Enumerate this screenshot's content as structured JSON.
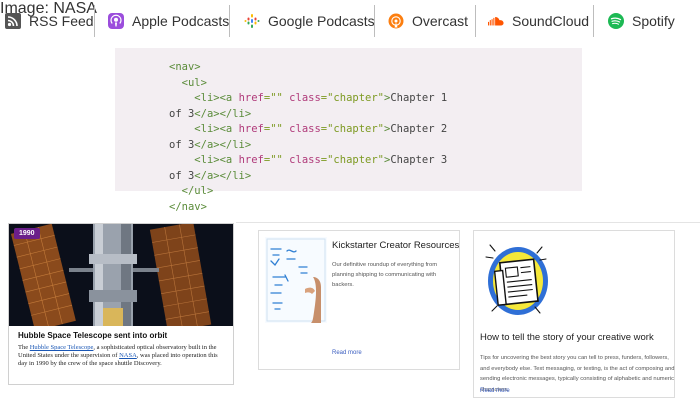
{
  "podcast_links": [
    {
      "label": "RSS Feed",
      "icon": "rss-icon",
      "color": "#555555"
    },
    {
      "label": "Apple Podcasts",
      "icon": "apple-podcasts-icon",
      "color": "#9b4ddc"
    },
    {
      "label": "Google Podcasts",
      "icon": "google-podcasts-icon",
      "color": "#4285f4"
    },
    {
      "label": "Overcast",
      "icon": "overcast-icon",
      "color": "#fc7e0f"
    },
    {
      "label": "SoundCloud",
      "icon": "soundcloud-icon",
      "color": "#ff5500"
    },
    {
      "label": "Spotify",
      "icon": "spotify-icon",
      "color": "#1db954"
    }
  ],
  "code": {
    "nav_open": "<nav>",
    "ul_open": "<ul>",
    "li_open": "<li>",
    "a_open": "<a",
    "href_attr": "href",
    "href_value": "=\"\"",
    "class_attr": "class",
    "class_value": "=\"chapter\"",
    "tag_close": ">",
    "items": [
      {
        "text_1": "Chapter 1",
        "text_2": "of 3"
      },
      {
        "text_1": "Chapter 2",
        "text_2": "of 3"
      },
      {
        "text_1": "Chapter 3",
        "text_2": "of 3"
      }
    ],
    "a_close": "</a>",
    "li_close": "</li>",
    "ul_close": "</ul>",
    "nav_close": "</nav>"
  },
  "news_card": {
    "badge": "1990",
    "title": "Hubble Space Telescope sent into orbit",
    "body_1": "The ",
    "link_1": "Hubble Space Telescope",
    "body_2": ", a sophisticated optical observatory built in the United States under the supervision of ",
    "link_2": "NASA",
    "body_3": ", was placed into operation this day in 1990 by the crew of the space shuttle Discovery.",
    "credit": "Image: NASA"
  },
  "resource_cards": [
    {
      "title": "Kickstarter Creator Resources",
      "description": "Our definitive roundup of everything from planning shipping to communicating with backers.",
      "more": "Read more"
    },
    {
      "title": "How to tell the story of your creative work",
      "description": "Tips for uncovering the best story you can tell to press, funders, followers, and everybody else. Text messaging, or texting, is the act of composing and sending electronic messages, typically consisting of alphabetic and numeric characters.",
      "more": "Read more"
    }
  ]
}
